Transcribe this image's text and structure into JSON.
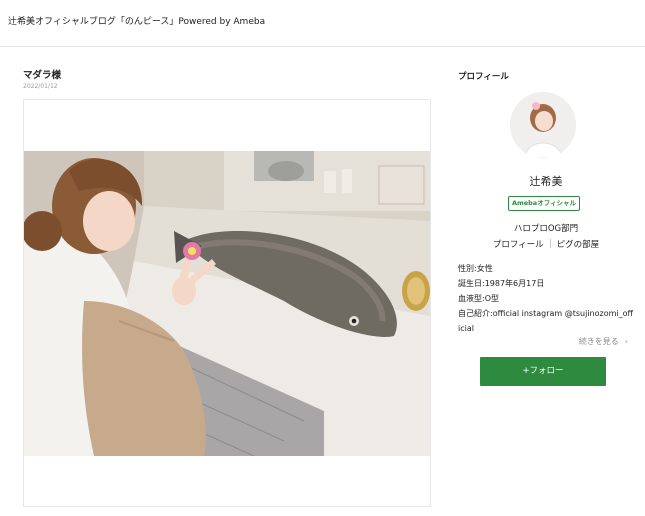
{
  "header": {
    "blog_title": "辻希美オフィシャルブログ「のんピース」Powered by Ameba"
  },
  "entry": {
    "title": "マダラ様",
    "date": "2022/01/12"
  },
  "sidebar": {
    "heading": "プロフィール",
    "name": "辻希美",
    "badge": "Amebaオフィシャル",
    "dept": "ハロプロOG部門",
    "link_profile": "プロフィール",
    "link_pigg": "ピグの部屋",
    "gender": "性別:女性",
    "birthday": "誕生日:1987年6月17日",
    "blood": "血液型:O型",
    "intro": "自己紹介:official instagram @tsujinozomi_official",
    "more": "続きを見る",
    "follow": "+フォロー"
  },
  "colors": {
    "accent_green": "#2d8a3e"
  }
}
